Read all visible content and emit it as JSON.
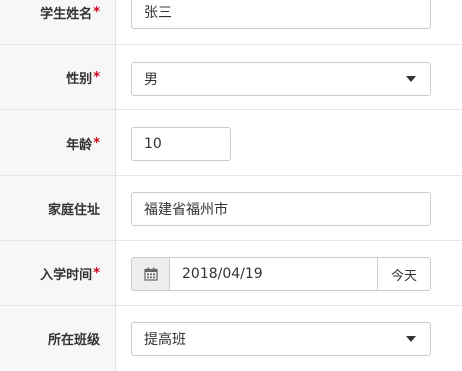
{
  "fields": {
    "name": {
      "label": "学生姓名",
      "required": "*",
      "value": "张三"
    },
    "gender": {
      "label": "性别",
      "required": "*",
      "value": "男"
    },
    "age": {
      "label": "年龄",
      "required": "*",
      "value": "10"
    },
    "address": {
      "label": "家庭住址",
      "value": "福建省福州市"
    },
    "enroll": {
      "label": "入学时间",
      "required": "*",
      "value": "2018/04/19",
      "today_button": "今天",
      "icon": "calendar-icon"
    },
    "class": {
      "label": "所在班级",
      "value": "提高班"
    }
  },
  "colors": {
    "required": "#d0021b",
    "label_bg": "#f7f7f7",
    "border": "#cccccc"
  }
}
